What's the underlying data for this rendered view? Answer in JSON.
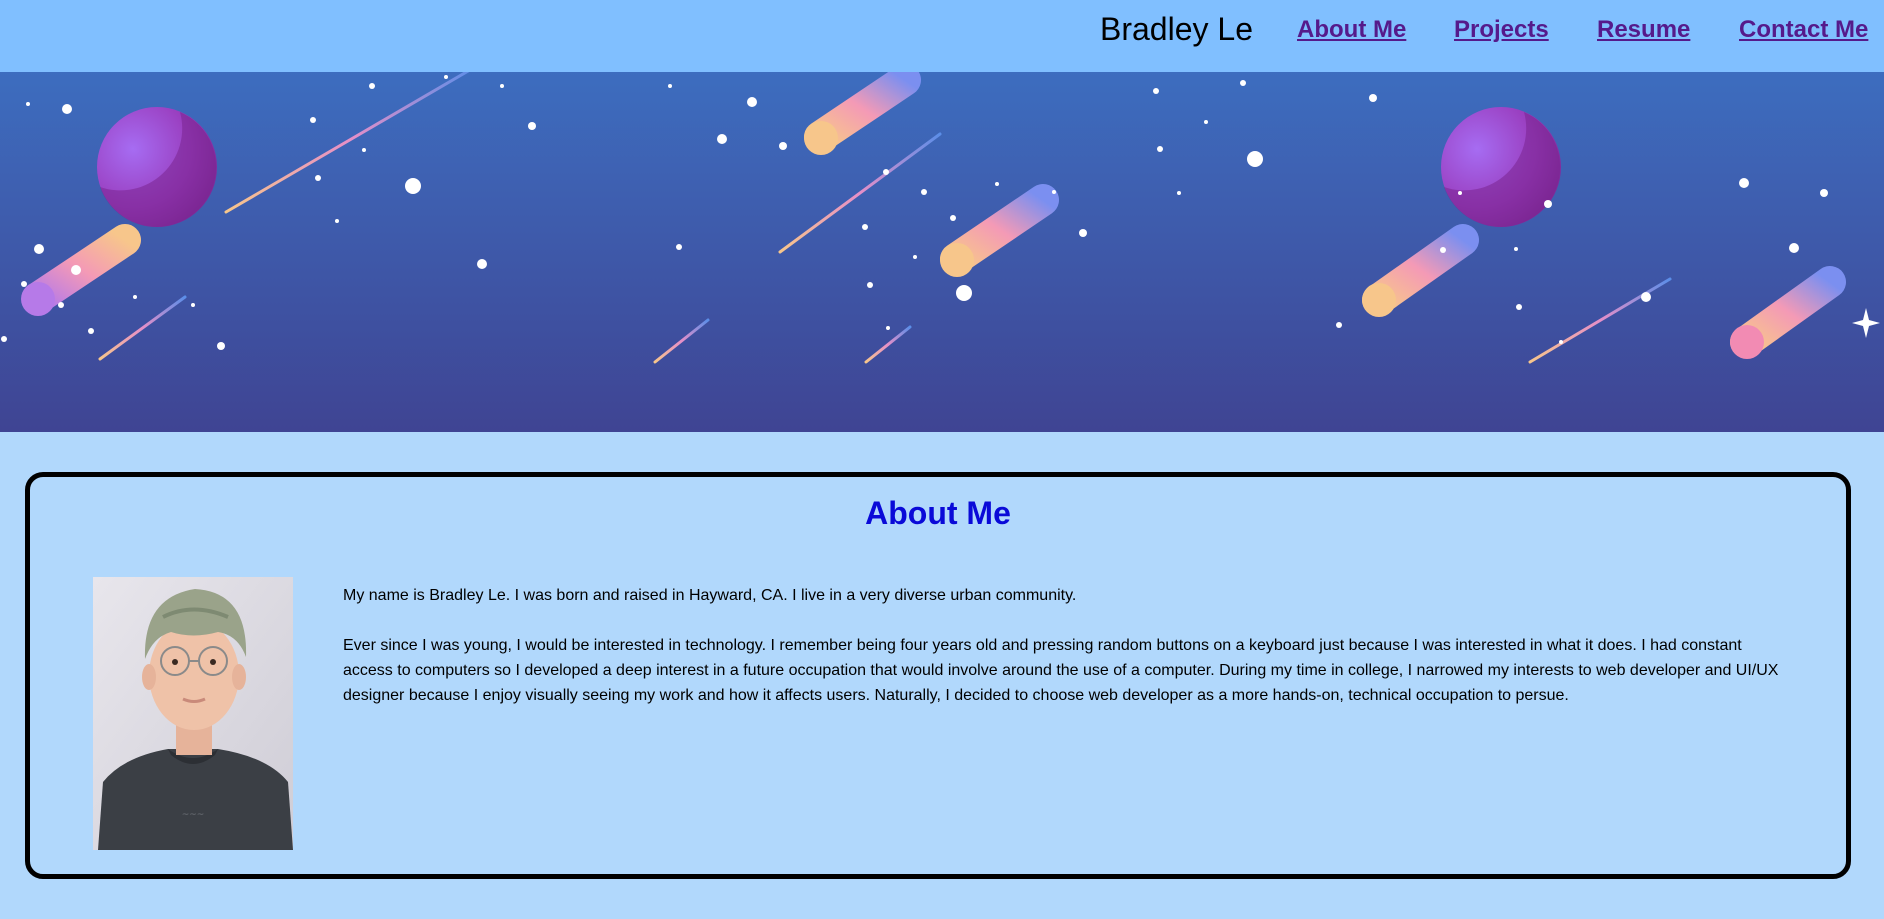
{
  "header": {
    "site_name": "Bradley Le",
    "nav": [
      {
        "label": "About Me"
      },
      {
        "label": "Projects"
      },
      {
        "label": "Resume"
      },
      {
        "label": "Contact Me"
      }
    ],
    "link_color": "#551a8b",
    "bar_color": "#80bfff"
  },
  "banner": {
    "theme": "space-comets-planets",
    "sky_top": "#3d6dbf",
    "sky_bottom": "#3f4493"
  },
  "about": {
    "title": "About Me",
    "title_color": "#0a0ad8",
    "photo": "portrait-photo",
    "paragraphs": [
      "My name is Bradley Le. I was born and raised in Hayward, CA. I live in a very diverse urban community.",
      "Ever since I was young, I would be interested in technology. I remember being four years old and pressing random buttons on a keyboard just because I was interested in what it does. I had constant access to computers so I developed a deep interest in a future occupation that would involve around the use of a computer. During my time in college, I narrowed my interests to web developer and UI/UX designer because I enjoy visually seeing my work and how it affects users. Naturally, I decided to choose web developer as a more hands-on, technical occupation to persue."
    ]
  },
  "page_background": "#b1d8fc"
}
